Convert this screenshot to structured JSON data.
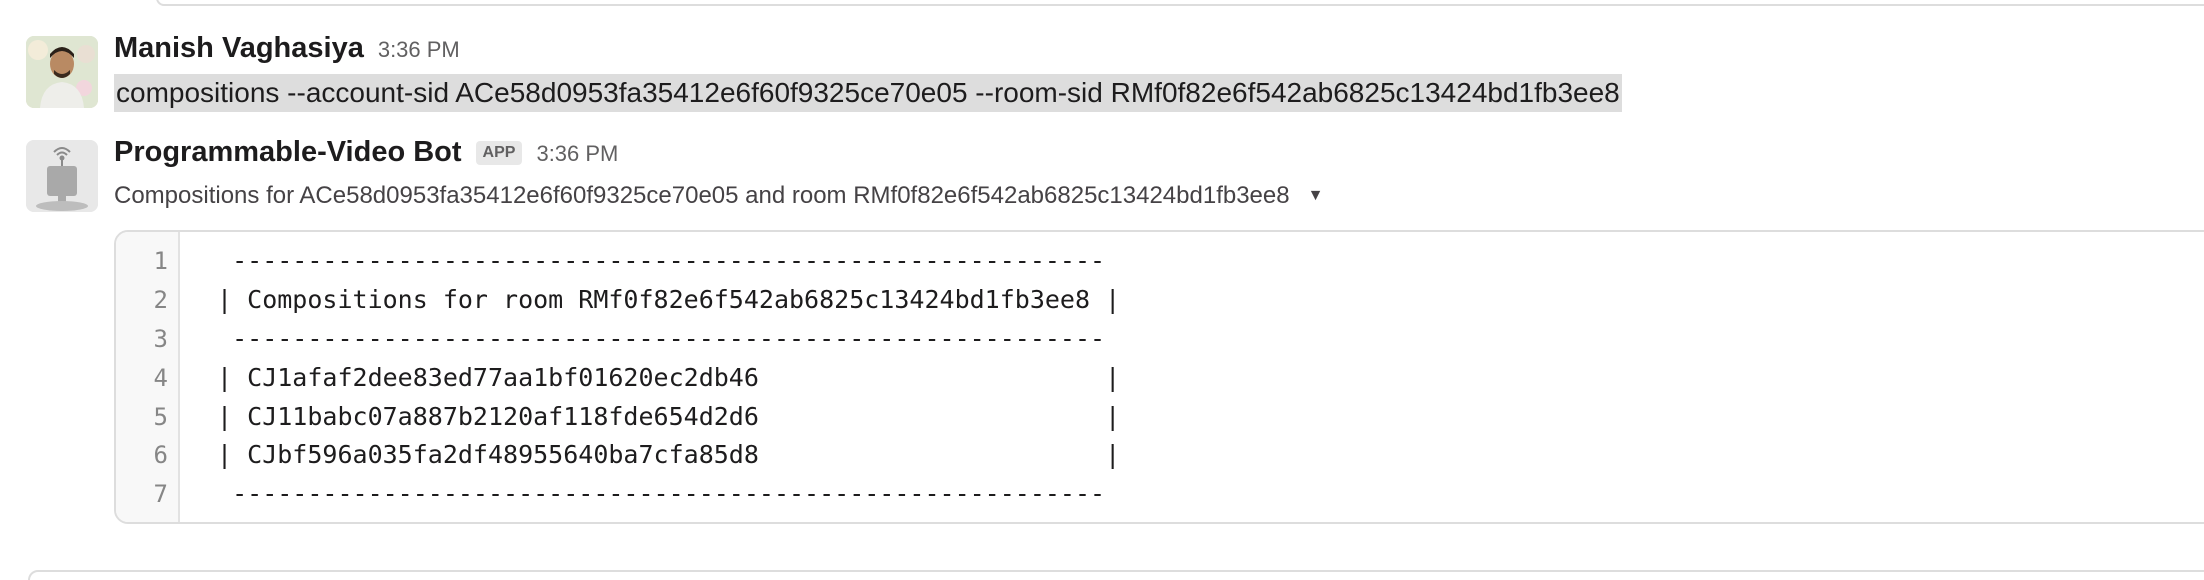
{
  "messages": [
    {
      "sender": "Manish Vaghasiya",
      "time": "3:36 PM",
      "text": "compositions --account-sid ACe58d0953fa35412e6f60f9325ce70e05 --room-sid RMf0f82e6f542ab6825c13424bd1fb3ee8"
    },
    {
      "sender": "Programmable-Video Bot",
      "badge": "APP",
      "time": "3:36 PM",
      "attachment": {
        "title": "Compositions for ACe58d0953fa35412e6f60f9325ce70e05 and room RMf0f82e6f542ab6825c13424bd1fb3ee8",
        "expand_icon": "caret-down-icon",
        "line_numbers": [
          "1",
          "2",
          "3",
          "4",
          "5",
          "6",
          "7"
        ],
        "lines": [
          "  ----------------------------------------------------------",
          " | Compositions for room RMf0f82e6f542ab6825c13424bd1fb3ee8 |",
          "  ----------------------------------------------------------",
          " | CJ1afaf2dee83ed77aa1bf01620ec2db46                       |",
          " | CJ11babc07a887b2120af118fde654d2d6                       |",
          " | CJbf596a035fa2df48955640ba7cfa85d8                       |",
          "  ----------------------------------------------------------"
        ]
      }
    }
  ]
}
